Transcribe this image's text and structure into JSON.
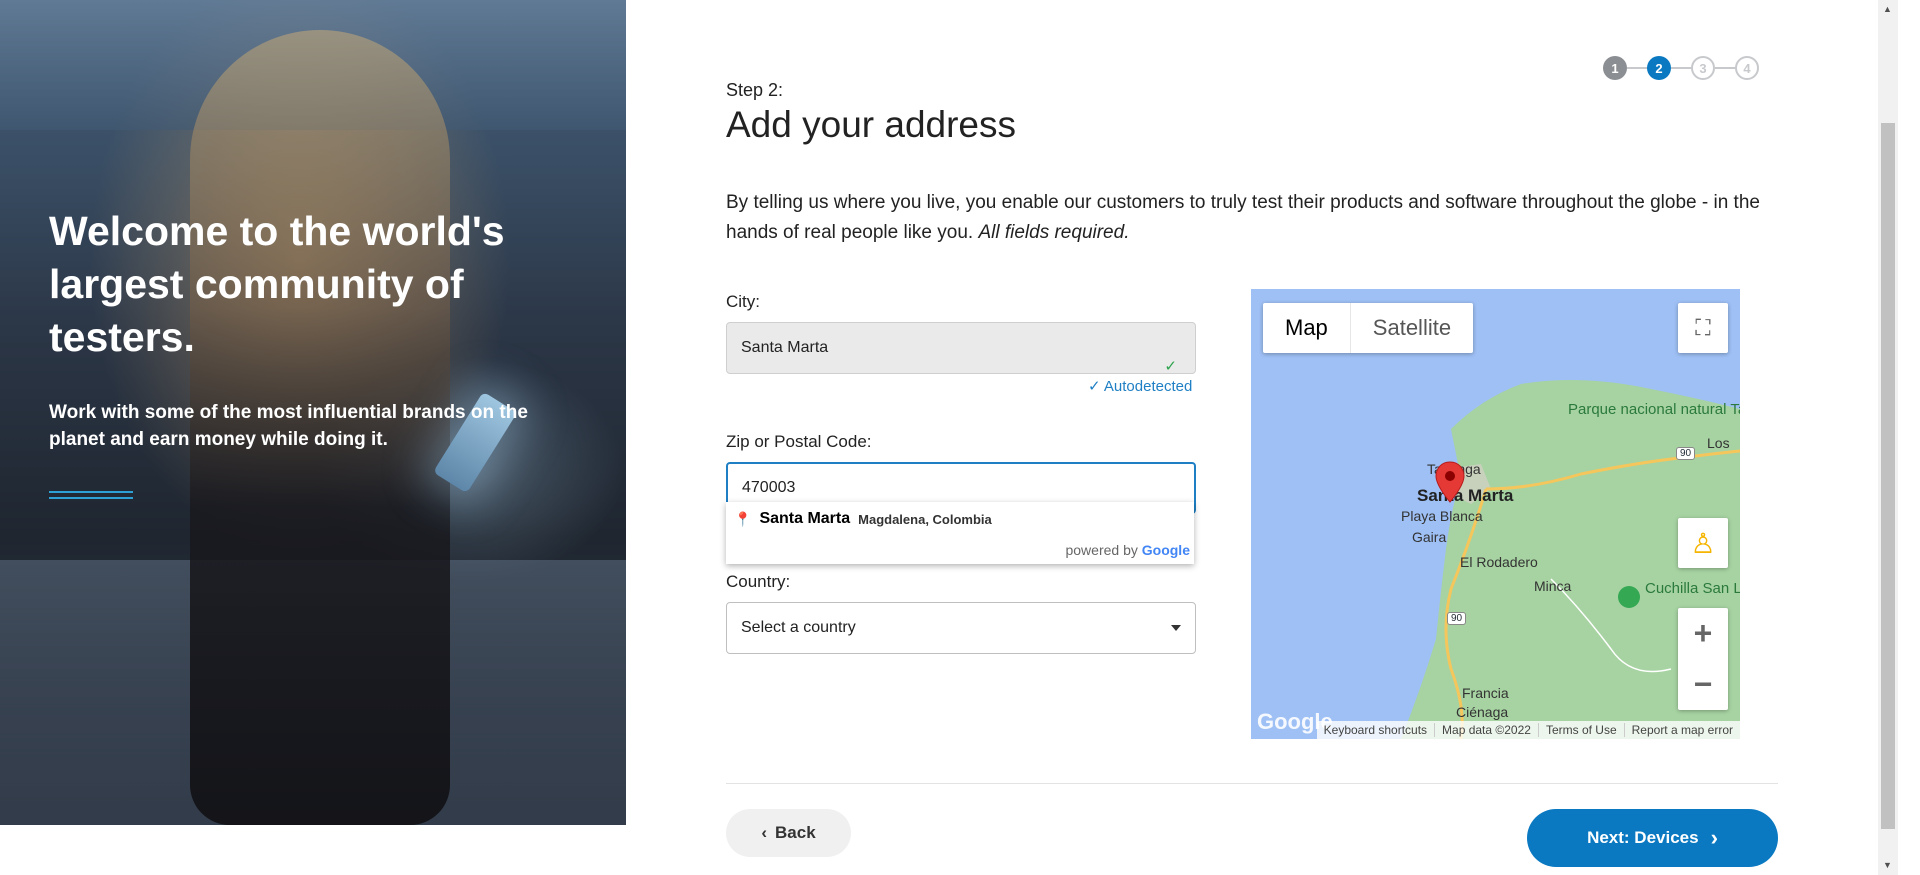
{
  "hero": {
    "title": "Welcome to the world's largest community of testers.",
    "subtitle": "Work with some of the most influential brands on the planet and earn money while doing it."
  },
  "stepper": {
    "steps": [
      "1",
      "2",
      "3",
      "4"
    ],
    "current": 2
  },
  "header": {
    "step_label": "Step 2:",
    "title": "Add your address"
  },
  "intro": {
    "text": "By telling us where you live, you enable our customers to truly test their products and software throughout the globe - in the hands of real people like you.",
    "required": "All fields required."
  },
  "form": {
    "city_label": "City:",
    "city_value": "Santa Marta",
    "autodetected": "Autodetected",
    "zip_label": "Zip or Postal Code:",
    "zip_value": "470003",
    "country_label": "Country:",
    "country_placeholder": "Select a country"
  },
  "autocomplete": {
    "main": "Santa Marta",
    "secondary": "Magdalena, Colombia",
    "powered_by": "powered by",
    "brand": "Google"
  },
  "map": {
    "tab_map": "Map",
    "tab_satellite": "Satellite",
    "labels": {
      "parque": "Parque nacional natural Tayrona",
      "los": "Los",
      "taganga": "Taganga",
      "santa_marta": "Santa Marta",
      "playa_blanca": "Playa Blanca",
      "gaira": "Gaira",
      "el_rodadero": "El Rodadero",
      "minca": "Minca",
      "cuchilla": "Cuchilla San Lorenzo",
      "francia": "Francia",
      "cienaga": "Ciénaga",
      "route_90a": "90",
      "route_90b": "90"
    },
    "logo": "Google",
    "attribution": {
      "shortcuts": "Keyboard shortcuts",
      "data": "Map data ©2022",
      "terms": "Terms of Use",
      "report": "Report a map error"
    },
    "colors": {
      "water": "#9ec0f5",
      "land": "#a7d3a2",
      "pin": "#e53935"
    }
  },
  "nav": {
    "back": "Back",
    "next": "Next: Devices"
  },
  "colors": {
    "accent": "#0a79c2",
    "link": "#1f7fc4"
  }
}
